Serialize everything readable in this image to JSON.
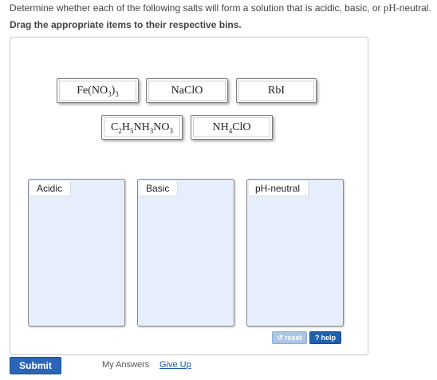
{
  "question": {
    "text_before": "Determine whether each of the following salts will form a solution that is acidic, basic, or ",
    "ph_text": "pH",
    "text_after": "-neutral."
  },
  "instruction": "Drag the appropriate items to their respective bins.",
  "tiles": [
    {
      "name": "Fe(NO3)3",
      "parts": {
        "a": "Fe(NO",
        "b": "3",
        "c": ")",
        "d": "3"
      }
    },
    {
      "name": "NaClO",
      "label": "NaClO"
    },
    {
      "name": "RbI",
      "label": "RbI"
    },
    {
      "name": "C2H5NH3NO3",
      "parts": {
        "a": "C",
        "b": "2",
        "c": "H",
        "d": "5",
        "e": "NH",
        "f": "3",
        "g": "NO",
        "h": "3"
      }
    },
    {
      "name": "NH4ClO",
      "parts": {
        "a": "NH",
        "b": "4",
        "c": "ClO"
      }
    }
  ],
  "bins": [
    {
      "label": "Acidic"
    },
    {
      "label": "Basic"
    },
    {
      "label": "pH-neutral"
    }
  ],
  "buttons": {
    "reset": "reset",
    "help": "help",
    "submit": "Submit"
  },
  "footer": {
    "my_answers": "My Answers",
    "give_up": "Give Up"
  },
  "colors": {
    "bin_fill": "#e6eefb",
    "submit_blue": "#2a66b8",
    "help_blue": "#1f5fae",
    "reset_blue": "#aac6e4",
    "link": "#1a56a8"
  }
}
